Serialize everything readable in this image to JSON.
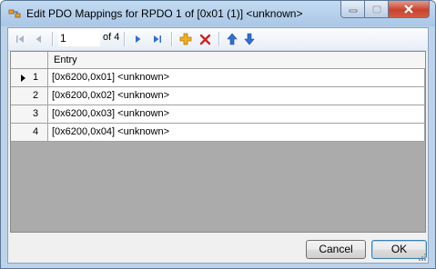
{
  "window": {
    "title": "Edit PDO Mappings for RPDO 1 of [0x01 (1)] <unknown>",
    "buttons": [
      "minimize",
      "maximize",
      "close"
    ]
  },
  "navigator": {
    "position_value": "1",
    "count_label": "of 4",
    "icons": [
      "move-first-icon",
      "move-previous-icon",
      "move-next-icon",
      "move-last-icon",
      "add-new-icon",
      "delete-icon",
      "move-up-icon",
      "move-down-icon"
    ]
  },
  "grid": {
    "columns": [
      "Entry"
    ],
    "rows": [
      {
        "num": "1",
        "entry": "[0x6200,0x01] <unknown>",
        "current": true
      },
      {
        "num": "2",
        "entry": "[0x6200,0x02] <unknown>",
        "current": false
      },
      {
        "num": "3",
        "entry": "[0x6200,0x03] <unknown>",
        "current": false
      },
      {
        "num": "4",
        "entry": "[0x6200,0x04] <unknown>",
        "current": false
      }
    ]
  },
  "footer": {
    "cancel_label": "Cancel",
    "ok_label": "OK"
  },
  "colors": {
    "add": "#f0b020",
    "delete": "#d42020",
    "nav_blue": "#2f6fd6"
  }
}
